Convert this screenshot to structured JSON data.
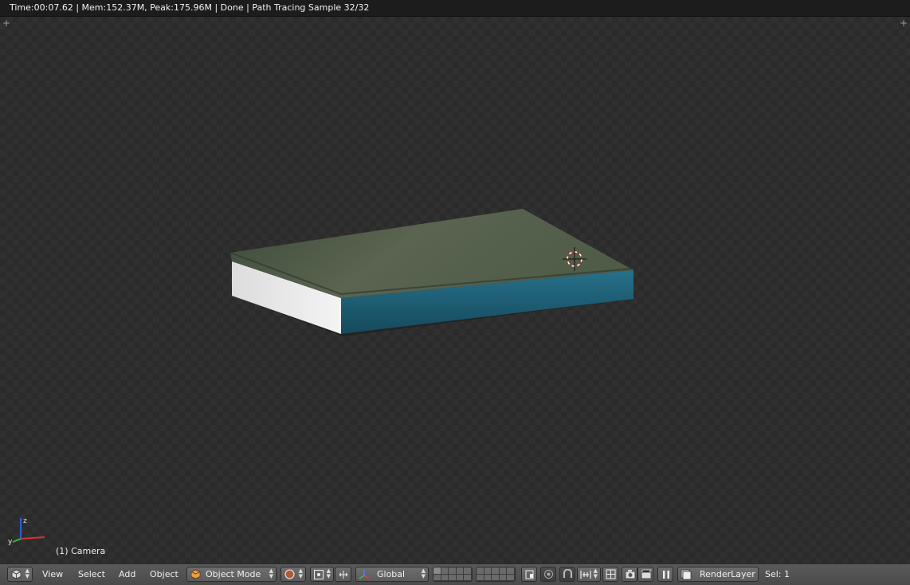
{
  "status": {
    "text": "Time:00:07.62 | Mem:152.37M, Peak:175.96M | Done | Path Tracing Sample 32/32"
  },
  "viewport": {
    "camera_label": "(1) Camera"
  },
  "header": {
    "menus": {
      "view": "View",
      "select": "Select",
      "add": "Add",
      "object": "Object"
    },
    "mode": "Object Mode",
    "orientation": "Global",
    "render_layer": "RenderLayer",
    "selection": "Sel: 1"
  },
  "colors": {
    "statusbar": "#1c1c1c",
    "viewport_checker_dark": "#2b2b2b",
    "viewport_checker_light": "#303030",
    "header": "#4a4a4a",
    "book_cover": "#4d5a46",
    "book_spine_edge": "#1f5d6e",
    "book_pages": "#e8e8e8"
  },
  "icons": {
    "editor_type": "cube-icon",
    "object_mode": "object-mode-cube-icon",
    "shading": "solid-sphere-icon",
    "pivot": "pivot-point-icon",
    "manipulator": "manipulator-icon",
    "transform_orientation": "transform-axes-icon",
    "proportional": "proportional-edit-icon",
    "snap": "snap-magnet-icon",
    "render": "camera-render-icon",
    "render_anim": "clapper-icon",
    "layers": "render-layer-icon",
    "cursor": "3d-cursor-icon"
  }
}
